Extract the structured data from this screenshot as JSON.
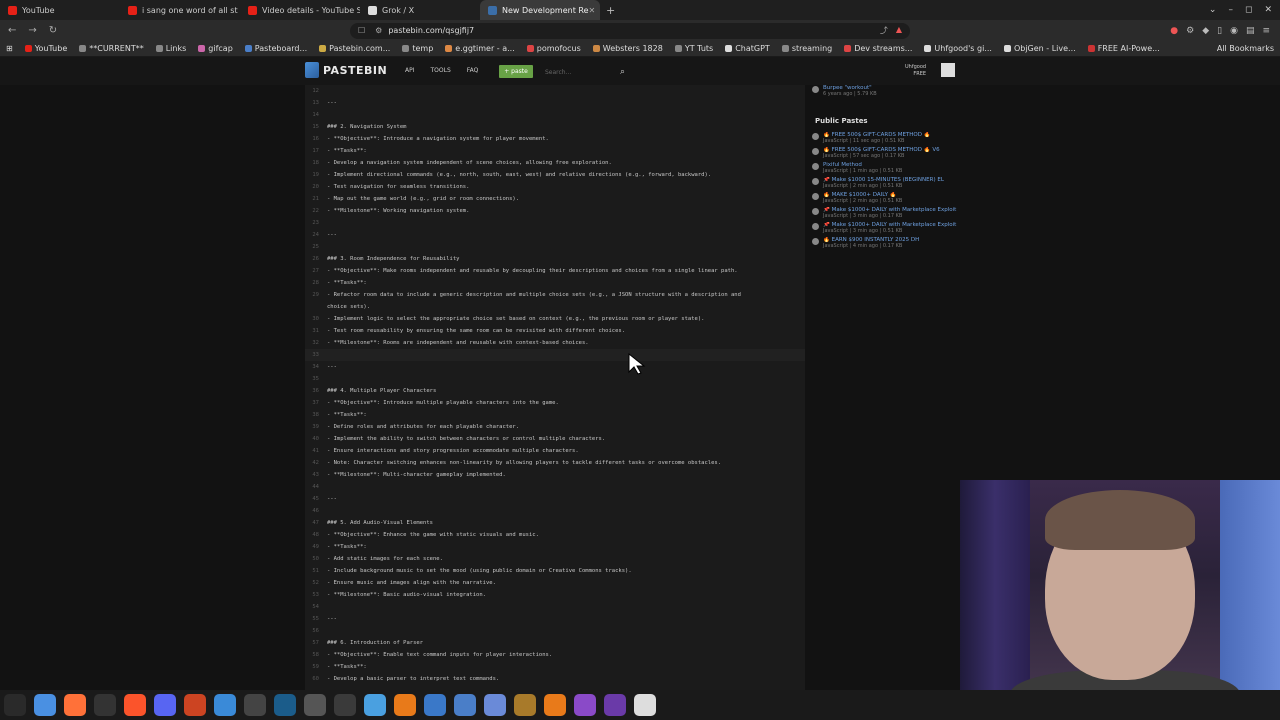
{
  "browser": {
    "tabs": [
      {
        "label": "YouTube",
        "color": "#e62117"
      },
      {
        "label": "i sang one word of all st",
        "color": "#e62117"
      },
      {
        "label": "Video details - YouTube S",
        "color": "#e62117"
      },
      {
        "label": "Grok / X",
        "color": "#dddddd"
      },
      {
        "label": "New Development Re",
        "color": "#3b6ea8",
        "active": true
      }
    ],
    "url": "pastebin.com/qsgjfij7",
    "bookmarks": [
      {
        "label": "YouTube",
        "color": "#e62117"
      },
      {
        "label": "**CURRENT**",
        "color": "#888888"
      },
      {
        "label": "Links",
        "color": "#888888"
      },
      {
        "label": "gifcap",
        "color": "#cc66aa"
      },
      {
        "label": "Pasteboard...",
        "color": "#4a7ec8"
      },
      {
        "label": "Pastebin.com...",
        "color": "#ccaa44"
      },
      {
        "label": "temp",
        "color": "#888888"
      },
      {
        "label": "e.ggtimer - a...",
        "color": "#dd8844"
      },
      {
        "label": "pomofocus",
        "color": "#dd4444"
      },
      {
        "label": "Websters 1828",
        "color": "#cc8844"
      },
      {
        "label": "YT Tuts",
        "color": "#888888"
      },
      {
        "label": "ChatGPT",
        "color": "#dddddd"
      },
      {
        "label": "streaming",
        "color": "#888888"
      },
      {
        "label": "Dev streams...",
        "color": "#dd4444"
      },
      {
        "label": "Uhfgood's gi...",
        "color": "#dddddd"
      },
      {
        "label": "ObjGen - Live...",
        "color": "#dddddd"
      },
      {
        "label": "FREE AI-Powe...",
        "color": "#cc3333"
      }
    ],
    "all_bookmarks": "All Bookmarks"
  },
  "pastebin": {
    "logo": "PASTEBIN",
    "nav": [
      "API",
      "TOOLS",
      "FAQ"
    ],
    "paste_button": "+ paste",
    "search_placeholder": "Search...",
    "user_name": "Uhfgood",
    "user_plan": "FREE"
  },
  "code_lines": [
    {
      "n": "12",
      "t": ""
    },
    {
      "n": "13",
      "t": "---"
    },
    {
      "n": "14",
      "t": ""
    },
    {
      "n": "15",
      "t": "### 2. Navigation System"
    },
    {
      "n": "16",
      "t": "- **Objective**: Introduce a navigation system for player movement."
    },
    {
      "n": "17",
      "t": "- **Tasks**:"
    },
    {
      "n": "18",
      "t": "  - Develop a navigation system independent of scene choices, allowing free exploration."
    },
    {
      "n": "19",
      "t": "  - Implement directional commands (e.g., north, south, east, west) and relative directions (e.g., forward, backward)."
    },
    {
      "n": "20",
      "t": "  - Test navigation for seamless transitions."
    },
    {
      "n": "21",
      "t": "  - Map out the game world (e.g., grid or room connections)."
    },
    {
      "n": "22",
      "t": "- **Milestone**: Working navigation system."
    },
    {
      "n": "23",
      "t": ""
    },
    {
      "n": "24",
      "t": "---"
    },
    {
      "n": "25",
      "t": ""
    },
    {
      "n": "26",
      "t": "### 3. Room Independence for Reusability"
    },
    {
      "n": "27",
      "t": "- **Objective**: Make rooms independent and reusable by decoupling their descriptions and choices from a single linear path."
    },
    {
      "n": "28",
      "t": "- **Tasks**:"
    },
    {
      "n": "29",
      "t": "  - Refactor room data to include a generic description and multiple choice sets (e.g., a JSON structure with a description and"
    },
    {
      "n": "",
      "t": "choice sets)."
    },
    {
      "n": "30",
      "t": "  - Implement logic to select the appropriate choice set based on context (e.g., the previous room or player state)."
    },
    {
      "n": "31",
      "t": "  - Test room reusability by ensuring the same room can be revisited with different choices."
    },
    {
      "n": "32",
      "t": "- **Milestone**: Rooms are independent and reusable with context-based choices."
    },
    {
      "n": "33",
      "t": ""
    },
    {
      "n": "34",
      "t": "---"
    },
    {
      "n": "35",
      "t": ""
    },
    {
      "n": "36",
      "t": "### 4. Multiple Player Characters"
    },
    {
      "n": "37",
      "t": "- **Objective**: Introduce multiple playable characters into the game."
    },
    {
      "n": "38",
      "t": "- **Tasks**:"
    },
    {
      "n": "39",
      "t": "  - Define roles and attributes for each playable character."
    },
    {
      "n": "40",
      "t": "  - Implement the ability to switch between characters or control multiple characters."
    },
    {
      "n": "41",
      "t": "  - Ensure interactions and story progression accommodate multiple characters."
    },
    {
      "n": "42",
      "t": "  - Note: Character switching enhances non-linearity by allowing players to tackle different tasks or overcome obstacles."
    },
    {
      "n": "43",
      "t": "- **Milestone**: Multi-character gameplay implemented."
    },
    {
      "n": "44",
      "t": ""
    },
    {
      "n": "45",
      "t": "---"
    },
    {
      "n": "46",
      "t": ""
    },
    {
      "n": "47",
      "t": "### 5. Add Audio-Visual Elements"
    },
    {
      "n": "48",
      "t": "- **Objective**: Enhance the game with static visuals and music."
    },
    {
      "n": "49",
      "t": "- **Tasks**:"
    },
    {
      "n": "50",
      "t": "  - Add static images for each scene."
    },
    {
      "n": "51",
      "t": "  - Include background music to set the mood (using public domain or Creative Commons tracks)."
    },
    {
      "n": "52",
      "t": "  - Ensure music and images align with the narrative."
    },
    {
      "n": "53",
      "t": "- **Milestone**: Basic audio-visual integration."
    },
    {
      "n": "54",
      "t": ""
    },
    {
      "n": "55",
      "t": "---"
    },
    {
      "n": "56",
      "t": ""
    },
    {
      "n": "57",
      "t": "### 6. Introduction of Parser"
    },
    {
      "n": "58",
      "t": "- **Objective**: Enable text command inputs for player interactions."
    },
    {
      "n": "59",
      "t": "- **Tasks**:"
    },
    {
      "n": "60",
      "t": "  - Develop a basic parser to interpret text commands."
    }
  ],
  "sidebar": {
    "my_pastes": [
      {
        "title": "Burpee \"workout\"",
        "meta": "6 years ago | 5.79 KB"
      }
    ],
    "public_heading": "Public Pastes",
    "public_pastes": [
      {
        "title": "🔥 FREE 500$ GIFT-CARDS METHOD 🔥",
        "meta": "JavaScript | 11 sec ago | 0.51 KB"
      },
      {
        "title": "🔥 FREE 500$ GIFT-CARDS METHOD 🔥 V6",
        "meta": "JavaScript | 57 sec ago | 0.17 KB"
      },
      {
        "title": "Pixiful Method",
        "meta": "JavaScript | 1 min ago | 0.51 KB"
      },
      {
        "title": "📌 Make $1000 15-MINUTES (BEGINNER) EL",
        "meta": "JavaScript | 2 min ago | 0.51 KB"
      },
      {
        "title": "🔥 MAKE $1000+ DAILY 🔥",
        "meta": "JavaScript | 2 min ago | 0.51 KB"
      },
      {
        "title": "📌 Make $1000+ DAILY with Marketplace Exploit",
        "meta": "JavaScript | 3 min ago | 0.17 KB"
      },
      {
        "title": "📌 Make $1000+ DAILY with Marketplace Exploit",
        "meta": "JavaScript | 3 min ago | 0.51 KB"
      },
      {
        "title": "🔥 EARN $900 INSTANTLY 2025 DH",
        "meta": "JavaScript | 4 min ago | 0.17 KB"
      }
    ]
  },
  "taskbar": {
    "icons": [
      {
        "name": "mint-menu-icon",
        "color": "#2a2a2a"
      },
      {
        "name": "files-icon",
        "color": "#4a90e2"
      },
      {
        "name": "firefox-icon",
        "color": "#ff7139"
      },
      {
        "name": "terminal-icon",
        "color": "#333333"
      },
      {
        "name": "brave-icon",
        "color": "#fb542b"
      },
      {
        "name": "discord-icon",
        "color": "#5865f2"
      },
      {
        "name": "app-icon",
        "color": "#cc4422"
      },
      {
        "name": "shield-icon",
        "color": "#3a8ad8"
      },
      {
        "name": "steam-icon",
        "color": "#444444"
      },
      {
        "name": "dev-icon",
        "color": "#1b5c8a"
      },
      {
        "name": "calculator-icon",
        "color": "#555555"
      },
      {
        "name": "camera-icon",
        "color": "#3a3a3a"
      },
      {
        "name": "browser-icon",
        "color": "#4aa0e0"
      },
      {
        "name": "player-icon",
        "color": "#e87a1a"
      },
      {
        "name": "mail-icon",
        "color": "#3a78c8"
      },
      {
        "name": "document-icon",
        "color": "#4a7ec8"
      },
      {
        "name": "notes-icon",
        "color": "#6a8ad8"
      },
      {
        "name": "tool-icon",
        "color": "#a87a2a"
      },
      {
        "name": "blender-icon",
        "color": "#e87a1a"
      },
      {
        "name": "github-icon",
        "color": "#8a4ac8"
      },
      {
        "name": "github-desktop-icon",
        "color": "#6a3aa8"
      },
      {
        "name": "settings-icon",
        "color": "#dddddd"
      }
    ]
  }
}
